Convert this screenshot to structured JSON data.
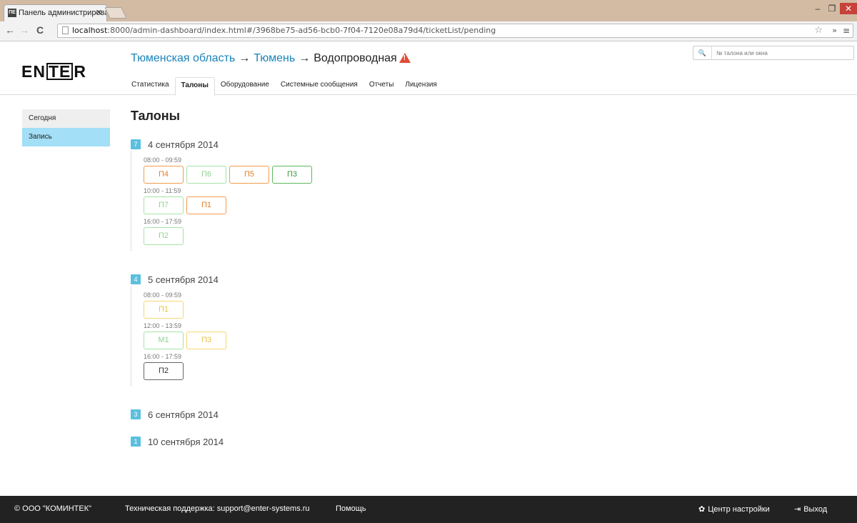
{
  "browser": {
    "tab_title": "Панель администрирова",
    "tab_favicon_text": "ПЕ",
    "url_host": "localhost",
    "url_rest": ":8000/admin-dashboard/index.html#/3968be75-ad56-bcb0-7f04-7120e08a79d4/ticketList/pending"
  },
  "header": {
    "logo_text": "ENTER",
    "breadcrumb": [
      "Тюменская область",
      "Тюмень",
      "Водопроводная"
    ],
    "arrow": "→",
    "tabs": [
      "Статистика",
      "Талоны",
      "Оборудование",
      "Системные сообщения",
      "Отчеты",
      "Лицензия"
    ],
    "active_tab": 1,
    "search_placeholder": "№ талона или окна"
  },
  "sidebar": {
    "items": [
      "Сегодня",
      "Запись"
    ],
    "active": 1
  },
  "main": {
    "title": "Талоны",
    "days": [
      {
        "count": "7",
        "date": "4 сентября 2014",
        "slots": [
          {
            "time": "08:00 - 09:59",
            "tickets": [
              {
                "label": "П4",
                "status": "orange"
              },
              {
                "label": "П6",
                "status": "lightgreen"
              },
              {
                "label": "П5",
                "status": "orange"
              },
              {
                "label": "П3",
                "status": "green"
              }
            ]
          },
          {
            "time": "10:00 - 11:59",
            "tickets": [
              {
                "label": "П7",
                "status": "lightgreen"
              },
              {
                "label": "П1",
                "status": "orange"
              }
            ]
          },
          {
            "time": "16:00 - 17:59",
            "tickets": [
              {
                "label": "П2",
                "status": "lightgreen"
              }
            ]
          }
        ]
      },
      {
        "count": "4",
        "date": "5 сентября 2014",
        "slots": [
          {
            "time": "08:00 - 09:59",
            "tickets": [
              {
                "label": "П1",
                "status": "yellow"
              }
            ]
          },
          {
            "time": "12:00 - 13:59",
            "tickets": [
              {
                "label": "М1",
                "status": "lightgreen"
              },
              {
                "label": "П3",
                "status": "yellow"
              }
            ]
          },
          {
            "time": "16:00 - 17:59",
            "tickets": [
              {
                "label": "П2",
                "status": "dark"
              }
            ]
          }
        ]
      },
      {
        "count": "3",
        "date": "6 сентября 2014",
        "slots": []
      },
      {
        "count": "1",
        "date": "10 сентября 2014",
        "slots": []
      }
    ]
  },
  "footer": {
    "copyright": "© ООО \"КОМИНТЕК\"",
    "support": "Техническая поддержка: support@enter-systems.ru",
    "help": "Помощь",
    "settings": "Центр настройки",
    "logout": "Выход"
  },
  "colors": {
    "link": "#1b84b9",
    "badge": "#5bc0de",
    "active_sidebar": "#a3dff6",
    "warning": "#e04b35",
    "footer_bg": "#222222"
  }
}
